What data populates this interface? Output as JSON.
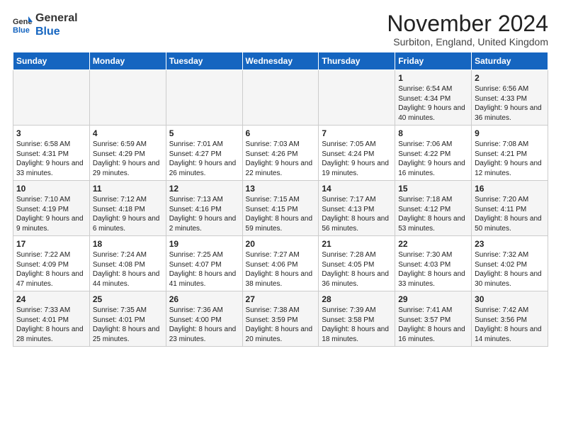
{
  "logo": {
    "general": "General",
    "blue": "Blue"
  },
  "title": "November 2024",
  "location": "Surbiton, England, United Kingdom",
  "headers": [
    "Sunday",
    "Monday",
    "Tuesday",
    "Wednesday",
    "Thursday",
    "Friday",
    "Saturday"
  ],
  "rows": [
    [
      {
        "day": "",
        "text": ""
      },
      {
        "day": "",
        "text": ""
      },
      {
        "day": "",
        "text": ""
      },
      {
        "day": "",
        "text": ""
      },
      {
        "day": "",
        "text": ""
      },
      {
        "day": "1",
        "text": "Sunrise: 6:54 AM\nSunset: 4:34 PM\nDaylight: 9 hours and 40 minutes."
      },
      {
        "day": "2",
        "text": "Sunrise: 6:56 AM\nSunset: 4:33 PM\nDaylight: 9 hours and 36 minutes."
      }
    ],
    [
      {
        "day": "3",
        "text": "Sunrise: 6:58 AM\nSunset: 4:31 PM\nDaylight: 9 hours and 33 minutes."
      },
      {
        "day": "4",
        "text": "Sunrise: 6:59 AM\nSunset: 4:29 PM\nDaylight: 9 hours and 29 minutes."
      },
      {
        "day": "5",
        "text": "Sunrise: 7:01 AM\nSunset: 4:27 PM\nDaylight: 9 hours and 26 minutes."
      },
      {
        "day": "6",
        "text": "Sunrise: 7:03 AM\nSunset: 4:26 PM\nDaylight: 9 hours and 22 minutes."
      },
      {
        "day": "7",
        "text": "Sunrise: 7:05 AM\nSunset: 4:24 PM\nDaylight: 9 hours and 19 minutes."
      },
      {
        "day": "8",
        "text": "Sunrise: 7:06 AM\nSunset: 4:22 PM\nDaylight: 9 hours and 16 minutes."
      },
      {
        "day": "9",
        "text": "Sunrise: 7:08 AM\nSunset: 4:21 PM\nDaylight: 9 hours and 12 minutes."
      }
    ],
    [
      {
        "day": "10",
        "text": "Sunrise: 7:10 AM\nSunset: 4:19 PM\nDaylight: 9 hours and 9 minutes."
      },
      {
        "day": "11",
        "text": "Sunrise: 7:12 AM\nSunset: 4:18 PM\nDaylight: 9 hours and 6 minutes."
      },
      {
        "day": "12",
        "text": "Sunrise: 7:13 AM\nSunset: 4:16 PM\nDaylight: 9 hours and 2 minutes."
      },
      {
        "day": "13",
        "text": "Sunrise: 7:15 AM\nSunset: 4:15 PM\nDaylight: 8 hours and 59 minutes."
      },
      {
        "day": "14",
        "text": "Sunrise: 7:17 AM\nSunset: 4:13 PM\nDaylight: 8 hours and 56 minutes."
      },
      {
        "day": "15",
        "text": "Sunrise: 7:18 AM\nSunset: 4:12 PM\nDaylight: 8 hours and 53 minutes."
      },
      {
        "day": "16",
        "text": "Sunrise: 7:20 AM\nSunset: 4:11 PM\nDaylight: 8 hours and 50 minutes."
      }
    ],
    [
      {
        "day": "17",
        "text": "Sunrise: 7:22 AM\nSunset: 4:09 PM\nDaylight: 8 hours and 47 minutes."
      },
      {
        "day": "18",
        "text": "Sunrise: 7:24 AM\nSunset: 4:08 PM\nDaylight: 8 hours and 44 minutes."
      },
      {
        "day": "19",
        "text": "Sunrise: 7:25 AM\nSunset: 4:07 PM\nDaylight: 8 hours and 41 minutes."
      },
      {
        "day": "20",
        "text": "Sunrise: 7:27 AM\nSunset: 4:06 PM\nDaylight: 8 hours and 38 minutes."
      },
      {
        "day": "21",
        "text": "Sunrise: 7:28 AM\nSunset: 4:05 PM\nDaylight: 8 hours and 36 minutes."
      },
      {
        "day": "22",
        "text": "Sunrise: 7:30 AM\nSunset: 4:03 PM\nDaylight: 8 hours and 33 minutes."
      },
      {
        "day": "23",
        "text": "Sunrise: 7:32 AM\nSunset: 4:02 PM\nDaylight: 8 hours and 30 minutes."
      }
    ],
    [
      {
        "day": "24",
        "text": "Sunrise: 7:33 AM\nSunset: 4:01 PM\nDaylight: 8 hours and 28 minutes."
      },
      {
        "day": "25",
        "text": "Sunrise: 7:35 AM\nSunset: 4:01 PM\nDaylight: 8 hours and 25 minutes."
      },
      {
        "day": "26",
        "text": "Sunrise: 7:36 AM\nSunset: 4:00 PM\nDaylight: 8 hours and 23 minutes."
      },
      {
        "day": "27",
        "text": "Sunrise: 7:38 AM\nSunset: 3:59 PM\nDaylight: 8 hours and 20 minutes."
      },
      {
        "day": "28",
        "text": "Sunrise: 7:39 AM\nSunset: 3:58 PM\nDaylight: 8 hours and 18 minutes."
      },
      {
        "day": "29",
        "text": "Sunrise: 7:41 AM\nSunset: 3:57 PM\nDaylight: 8 hours and 16 minutes."
      },
      {
        "day": "30",
        "text": "Sunrise: 7:42 AM\nSunset: 3:56 PM\nDaylight: 8 hours and 14 minutes."
      }
    ]
  ]
}
